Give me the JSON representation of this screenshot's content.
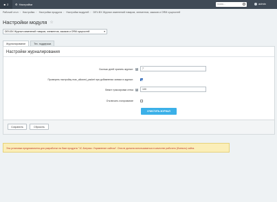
{
  "topbar": {
    "counter": "2",
    "settings_label": "Настройки",
    "search_placeholder": "поиск...",
    "user_name": "admin"
  },
  "breadcrumbs": [
    "Рабочий стол",
    "Настройки",
    "Настройки продукта",
    "Настройки модулей",
    "DEV-BX Журнал изменений товаров, элементов, заказов и ORM сущностей"
  ],
  "page": {
    "title": "Настройки модуля",
    "module_select_value": "DEV-BX Журнал изменений товаров, элементов, заказов и ORM сущностей"
  },
  "tabs": [
    {
      "label": "Журналирование",
      "active": true
    },
    {
      "label": "Тех. поддержка",
      "active": false
    }
  ],
  "form": {
    "section_title": "Настройки журналирования",
    "days_label": "Сколько дней хранить журнал:",
    "days_value": "7",
    "check_packet_label": "Проверять настройку max_allowed_packet при добавлении записи в журнал:",
    "check_packet_checked": true,
    "trace_label": "Лимит трассировки стека",
    "trace_value": "100",
    "disable_label": "Отключить логирование",
    "disable_checked": false,
    "clear_button": "ОЧИСТИТЬ ЖУРНАЛ"
  },
  "footer": {
    "save_label": "Сохранить",
    "reset_label": "Сбросить"
  },
  "notice": "Эта установка предназначена для разработки на базе продукта \"1С-Битрикс: Управление сайтом\". Она не должна использоваться в качестве рабочего (боевого) сайта."
}
